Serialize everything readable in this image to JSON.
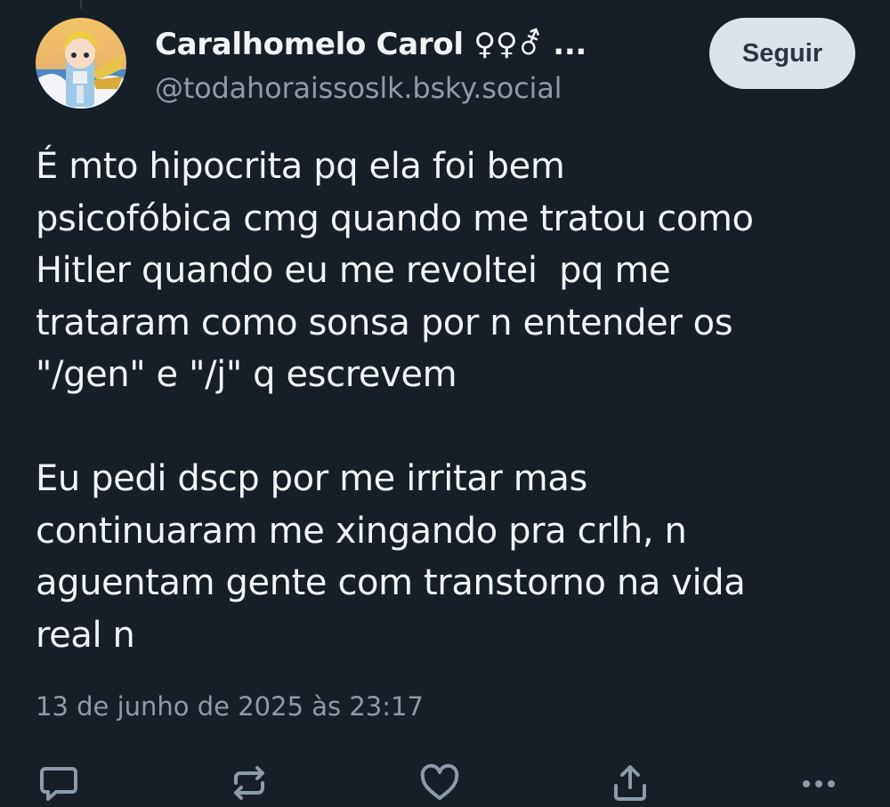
{
  "post": {
    "author": {
      "display_name": "Caralhomelo Carol ♀♀⚦ ...",
      "handle": "@todahoraissoslk.bsky.social",
      "avatar_icon": "anime-character-avatar"
    },
    "follow_label": "Seguir",
    "text": "É mto hipocrita pq ela foi bem\npsicofóbica cmg quando me tratou como\nHitler quando eu me revoltei  pq me\ntrataram como sonsa por n entender os\n\"/gen\" e \"/j\" q escrevem\n\nEu pedi dscp por me irritar mas\ncontinuaram me xingando pra crlh, n\naguentam gente com transtorno na vida\nreal n",
    "timestamp": "13 de junho de 2025 às 23:17",
    "actions": [
      {
        "name": "reply",
        "icon": "comment-icon"
      },
      {
        "name": "repost",
        "icon": "repost-icon"
      },
      {
        "name": "like",
        "icon": "heart-icon"
      },
      {
        "name": "share",
        "icon": "share-icon"
      },
      {
        "name": "more",
        "icon": "more-options-icon"
      }
    ]
  },
  "colors": {
    "background": "#161e27",
    "text_primary": "#f1f3f5",
    "text_secondary": "#8c9bab",
    "button_bg": "#dde3ea",
    "button_text": "#2a3644",
    "icon": "#8c9bab"
  }
}
